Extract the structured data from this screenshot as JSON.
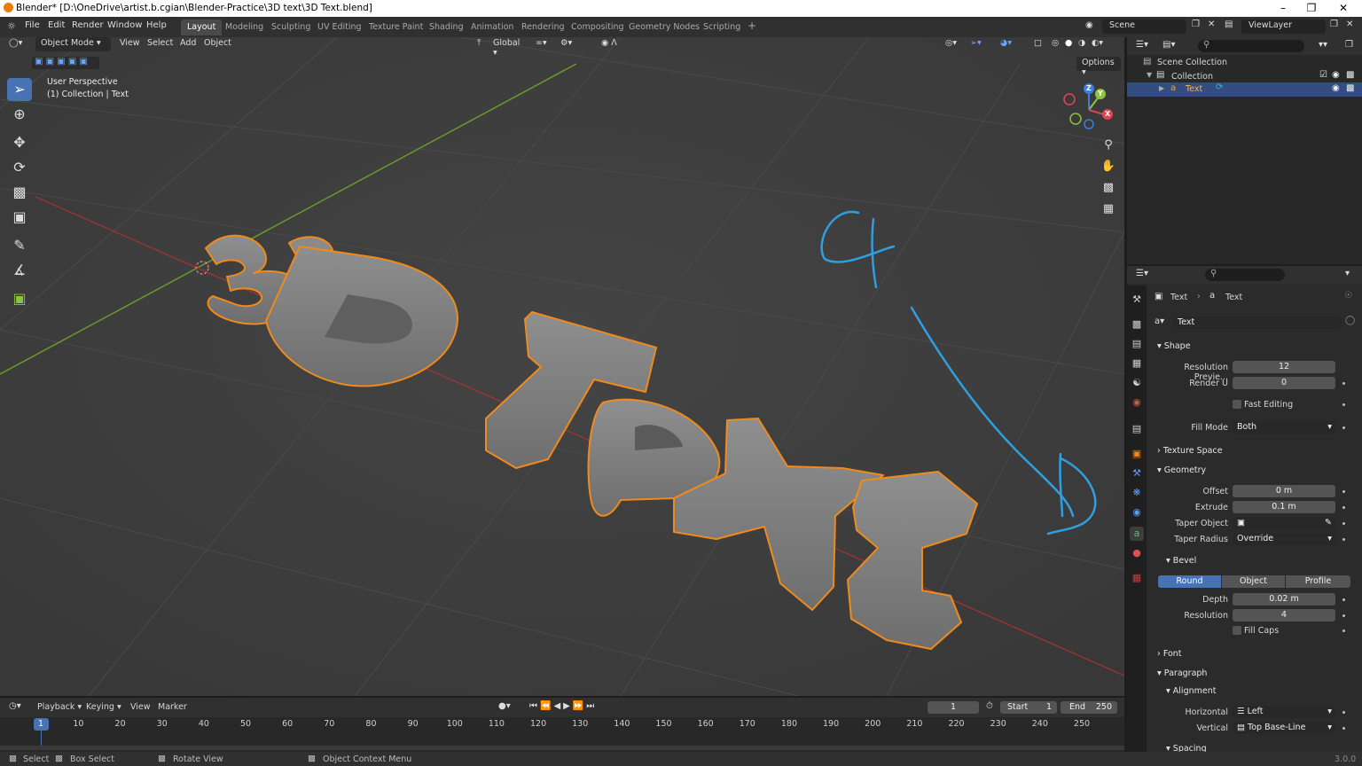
{
  "window": {
    "title": "Blender* [D:\\OneDrive\\artist.b.cgian\\Blender-Practice\\3D text\\3D Text.blend]"
  },
  "menus": [
    "File",
    "Edit",
    "Render",
    "Window",
    "Help"
  ],
  "workspaces": [
    "Layout",
    "Modeling",
    "Sculpting",
    "UV Editing",
    "Texture Paint",
    "Shading",
    "Animation",
    "Rendering",
    "Compositing",
    "Geometry Nodes",
    "Scripting"
  ],
  "active_workspace": "Layout",
  "scene": "Scene",
  "view_layer": "ViewLayer",
  "viewport": {
    "mode": "Object Mode",
    "menus": [
      "View",
      "Select",
      "Add",
      "Object"
    ],
    "orientation": "Global",
    "options": "Options",
    "overlay_line1": "User Perspective",
    "overlay_line2": "(1) Collection | Text",
    "object_text": "3D Text",
    "gizmo_axes": [
      "Z",
      "Y",
      "X"
    ],
    "annotation": "hand-drawn blue marks",
    "selection_color": "#f08a1c",
    "x_axis_color": "#a83333",
    "y_axis_color": "#6b9a2a"
  },
  "tools": [
    "cursor-select",
    "cursor",
    "move",
    "rotate",
    "scale",
    "transform",
    "annotate",
    "measure",
    "add-cube"
  ],
  "outliner": {
    "items": [
      {
        "label": "Scene Collection"
      },
      {
        "label": "Collection"
      },
      {
        "label": "Text"
      }
    ]
  },
  "properties": {
    "breadcrumb": [
      "Text",
      "Text"
    ],
    "datablock": "Text",
    "shape": {
      "header": "Shape",
      "resolution_preview_label": "Resolution Previe...",
      "resolution_preview": "12",
      "render_u_label": "Render U",
      "render_u": "0",
      "fast_editing": "Fast Editing",
      "fill_mode_label": "Fill Mode",
      "fill_mode": "Both"
    },
    "texture_space": "Texture Space",
    "geometry": {
      "header": "Geometry",
      "offset_label": "Offset",
      "offset": "0 m",
      "extrude_label": "Extrude",
      "extrude": "0.1 m",
      "taper_object_label": "Taper Object",
      "taper_radius_label": "Taper Radius",
      "taper_radius": "Override"
    },
    "bevel": {
      "header": "Bevel",
      "modes": [
        "Round",
        "Object",
        "Profile"
      ],
      "active_mode": "Round",
      "depth_label": "Depth",
      "depth": "0.02 m",
      "resolution_label": "Resolution",
      "resolution": "4",
      "fill_caps": "Fill Caps"
    },
    "font": "Font",
    "paragraph": {
      "header": "Paragraph",
      "alignment": "Alignment",
      "horizontal_label": "Horizontal",
      "horizontal": "Left",
      "vertical_label": "Vertical",
      "vertical": "Top Base-Line",
      "spacing": "Spacing"
    }
  },
  "timeline": {
    "menus": [
      "Playback",
      "Keying",
      "View",
      "Marker"
    ],
    "current_frame": "1",
    "start_label": "Start",
    "start": "1",
    "end_label": "End",
    "end": "250",
    "ticks": [
      "1",
      "10",
      "20",
      "30",
      "40",
      "50",
      "60",
      "70",
      "80",
      "90",
      "100",
      "110",
      "120",
      "130",
      "140",
      "150",
      "160",
      "170",
      "180",
      "190",
      "200",
      "210",
      "220",
      "230",
      "240",
      "250"
    ]
  },
  "status": {
    "select": "Select",
    "box_select": "Box Select",
    "rotate_view": "Rotate View",
    "context_menu": "Object Context Menu",
    "version": "3.0.0"
  }
}
